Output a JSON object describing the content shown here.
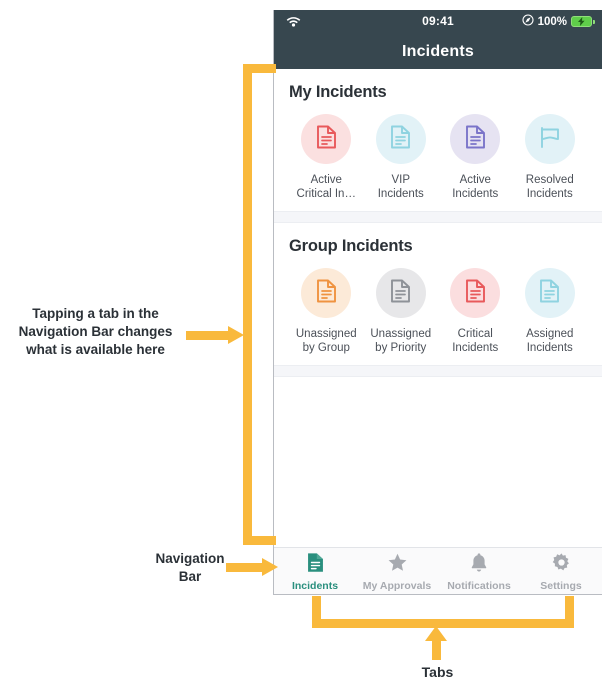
{
  "phone": {
    "status_bar": {
      "wifi_icon": "wifi-icon",
      "time": "09:41",
      "location_icon": "location-services-icon",
      "battery_percent": "100%",
      "battery_icon": "battery-charging-icon"
    },
    "nav_title": "Incidents",
    "sections": [
      {
        "title": "My Incidents",
        "tiles": [
          {
            "label": "Active\nCritical In…",
            "icon": "document-icon",
            "icon_color": "#e8595b",
            "bubble_color": "#fbe0e0"
          },
          {
            "label": "VIP\nIncidents",
            "icon": "document-icon",
            "icon_color": "#8fd3e0",
            "bubble_color": "#e2f2f7"
          },
          {
            "label": "Active\nIncidents",
            "icon": "document-icon",
            "icon_color": "#7b74c9",
            "bubble_color": "#e6e3f2"
          },
          {
            "label": "Resolved\nIncidents",
            "icon": "flag-icon",
            "icon_color": "#8fd3e0",
            "bubble_color": "#e2f2f7"
          }
        ]
      },
      {
        "title": "Group Incidents",
        "tiles": [
          {
            "label": "Unassigned\nby Group",
            "icon": "document-icon",
            "icon_color": "#ef9340",
            "bubble_color": "#fcead8"
          },
          {
            "label": "Unassigned\nby Priority",
            "icon": "document-icon",
            "icon_color": "#8e9298",
            "bubble_color": "#e7e7e9"
          },
          {
            "label": "Critical\nIncidents",
            "icon": "document-icon",
            "icon_color": "#e8595b",
            "bubble_color": "#fbdedf"
          },
          {
            "label": "Assigned\nIncidents",
            "icon": "document-icon",
            "icon_color": "#8fd3e0",
            "bubble_color": "#e2f2f7"
          }
        ]
      }
    ],
    "tab_bar": {
      "tabs": [
        {
          "label": "Incidents",
          "icon": "document-icon",
          "active": true
        },
        {
          "label": "My Approvals",
          "icon": "star-icon",
          "active": false
        },
        {
          "label": "Notifications",
          "icon": "bell-icon",
          "active": false
        },
        {
          "label": "Settings",
          "icon": "gear-icon",
          "active": false
        }
      ],
      "active_color": "#2a8f7e",
      "inactive_color": "#a7aab0"
    }
  },
  "annotations": {
    "content_area": "Tapping a tab in the\nNavigation Bar changes\nwhat is available here",
    "navigation_bar": "Navigation\nBar",
    "tabs": "Tabs",
    "callout_color": "#f9b93c"
  }
}
